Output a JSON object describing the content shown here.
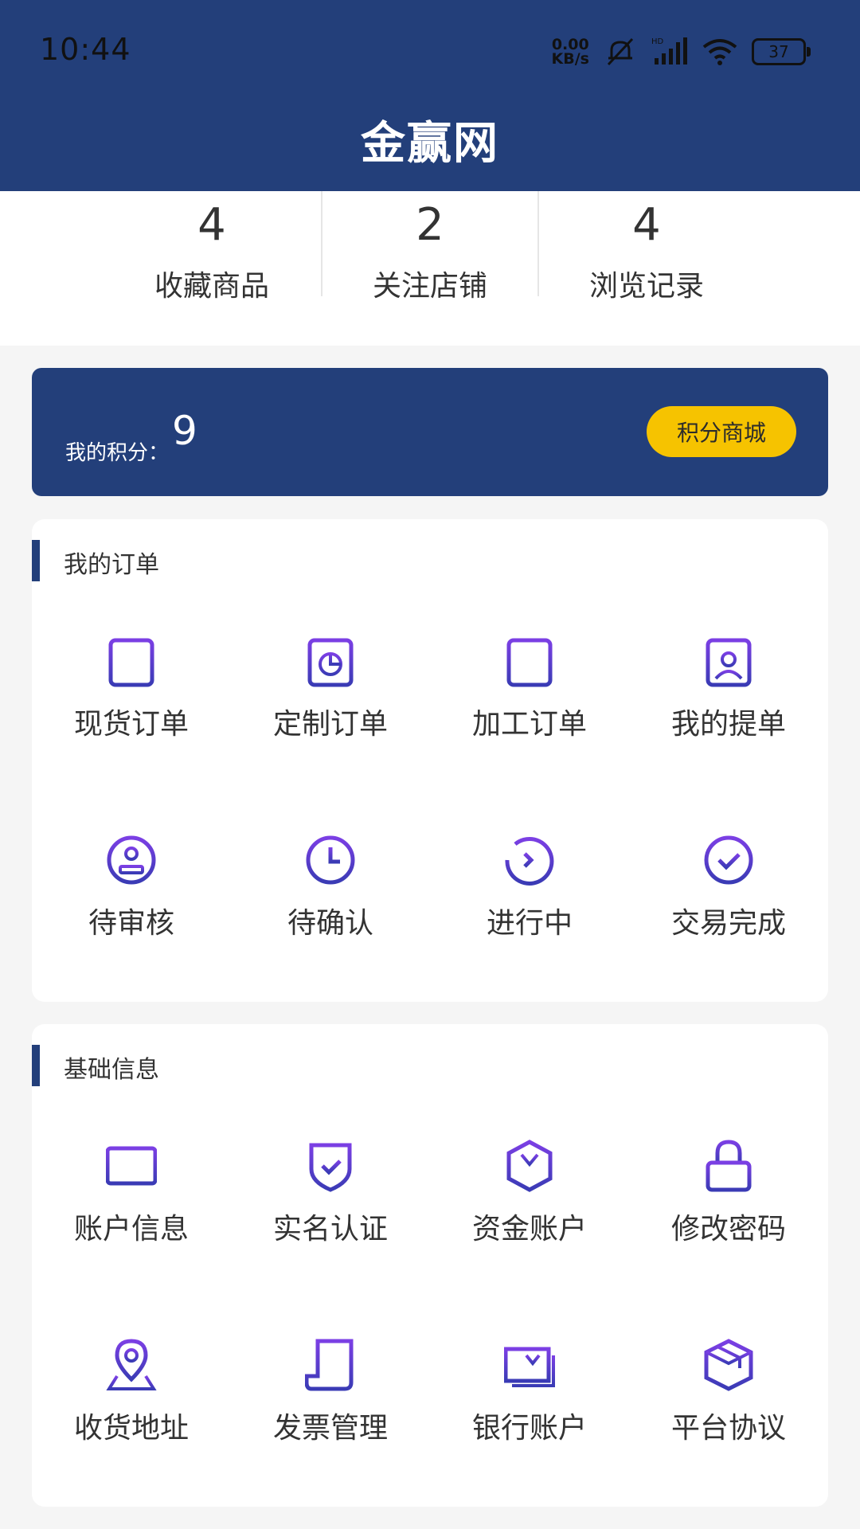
{
  "status_bar": {
    "time": "10:44",
    "net_speed_value": "0.00",
    "net_speed_unit": "KB/s",
    "battery": "37",
    "icons": [
      "mute-icon",
      "hd-signal-icon",
      "wifi-icon",
      "battery-icon"
    ]
  },
  "header": {
    "title": "金赢网"
  },
  "stats": [
    {
      "value": "4",
      "label": "收藏商品"
    },
    {
      "value": "2",
      "label": "关注店铺"
    },
    {
      "value": "4",
      "label": "浏览记录"
    }
  ],
  "points": {
    "label": "我的积分：",
    "value": "9",
    "button_label": "积分商城"
  },
  "orders": {
    "title": "我的订单",
    "items": [
      {
        "label": "现货订单",
        "icon": "clipboard-list-icon"
      },
      {
        "label": "定制订单",
        "icon": "clipboard-chart-icon"
      },
      {
        "label": "加工订单",
        "icon": "clipboard-tool-icon"
      },
      {
        "label": "我的提单",
        "icon": "clipboard-user-icon"
      },
      {
        "label": "待审核",
        "icon": "stamp-icon"
      },
      {
        "label": "待确认",
        "icon": "clock-icon"
      },
      {
        "label": "进行中",
        "icon": "progress-icon"
      },
      {
        "label": "交易完成",
        "icon": "check-circle-icon"
      }
    ]
  },
  "basic": {
    "title": "基础信息",
    "items": [
      {
        "label": "账户信息",
        "icon": "card-icon"
      },
      {
        "label": "实名认证",
        "icon": "shield-check-icon"
      },
      {
        "label": "资金账户",
        "icon": "yen-hexagon-icon"
      },
      {
        "label": "修改密码",
        "icon": "lock-icon"
      },
      {
        "label": "收货地址",
        "icon": "location-pin-icon"
      },
      {
        "label": "发票管理",
        "icon": "invoice-icon"
      },
      {
        "label": "银行账户",
        "icon": "bank-note-icon"
      },
      {
        "label": "平台协议",
        "icon": "box-icon"
      }
    ]
  },
  "colors": {
    "primary": "#233f7a",
    "accent": "#f6c300",
    "icon_gradient_start": "#7b3fe4",
    "icon_gradient_end": "#3a3bb5"
  }
}
